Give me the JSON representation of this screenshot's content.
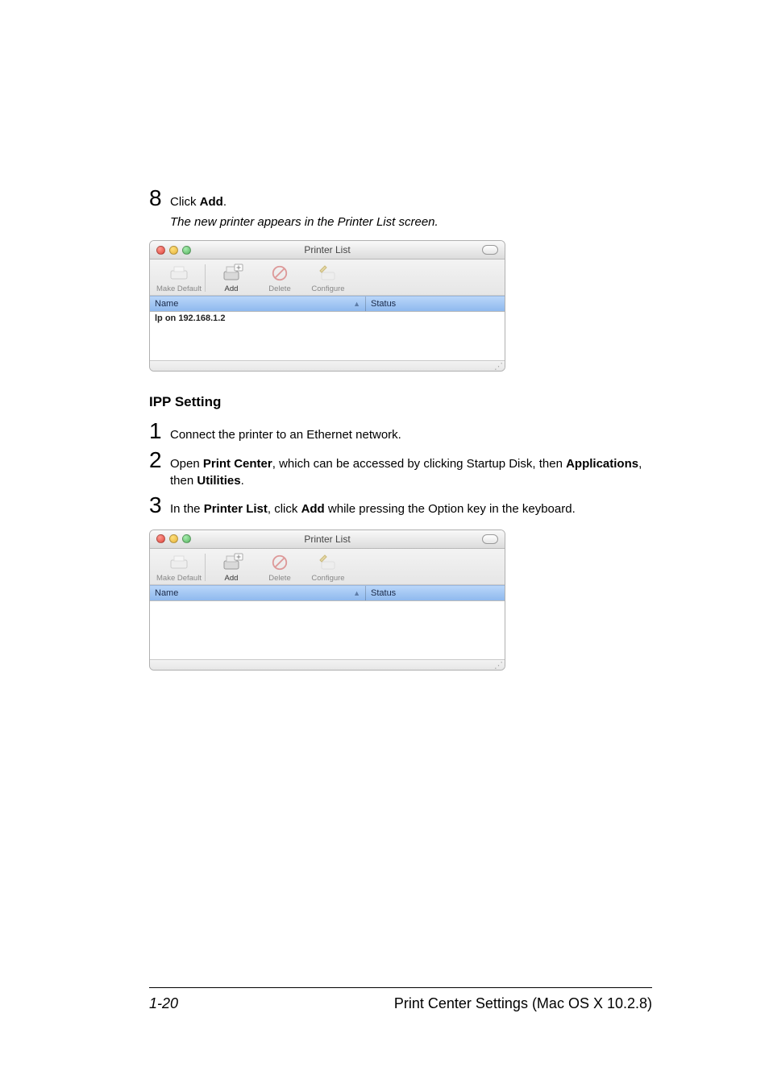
{
  "steps_top": {
    "num8": "8",
    "click_add_pre": "Click ",
    "add_word": "Add",
    "click_add_post": ".",
    "result_line": "The new printer appears in the Printer List screen."
  },
  "heading": "IPP Setting",
  "steps_bottom": {
    "num1": "1",
    "s1": "Connect the printer to an Ethernet network.",
    "num2": "2",
    "s2_pre": "Open ",
    "s2_bold1": "Print Center",
    "s2_mid": ", which can be accessed by clicking Startup Disk, then ",
    "s2_bold2": "Applications",
    "s2_mid2": ", then ",
    "s2_bold3": "Utilities",
    "s2_post": ".",
    "num3": "3",
    "s3_pre": "In the ",
    "s3_bold1": "Printer List",
    "s3_mid": ", click ",
    "s3_bold2": "Add",
    "s3_post": " while pressing the Option key in the keyboard."
  },
  "window": {
    "title": "Printer List",
    "tool_makedefault": "Make Default",
    "tool_add": "Add",
    "tool_delete": "Delete",
    "tool_configure": "Configure",
    "col_name": "Name",
    "col_status": "Status",
    "row1": "lp on 192.168.1.2"
  },
  "footer": {
    "page": "1-20",
    "right": "Print Center Settings (Mac OS X 10.2.8)"
  }
}
